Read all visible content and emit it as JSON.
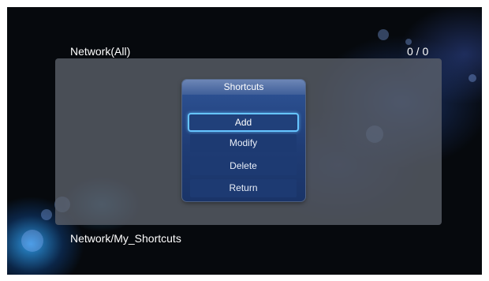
{
  "header": {
    "title": "Network(All)",
    "count": "0 / 0"
  },
  "dialog": {
    "title": "Shortcuts",
    "items": [
      {
        "label": "Add",
        "selected": true
      },
      {
        "label": "Modify",
        "selected": false
      },
      {
        "label": "Delete",
        "selected": false
      },
      {
        "label": "Return",
        "selected": false
      }
    ]
  },
  "footer": {
    "path": "Network/My_Shortcuts"
  },
  "colors": {
    "background": "#05070a",
    "panel": "#5c626c",
    "dialog": "#1f3c75",
    "selection_border": "#66c4ff",
    "text": "#ffffff"
  }
}
